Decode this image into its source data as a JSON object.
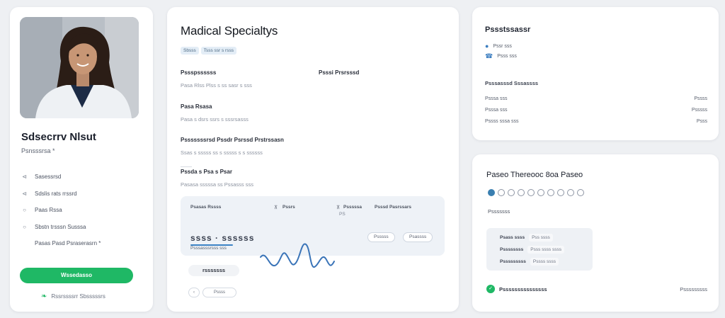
{
  "profile": {
    "name": "Sdsecrrv Nlsut",
    "role": "Psnsssrsa *",
    "items": [
      {
        "icon": "bullet-icon",
        "label": "Sasessrsd"
      },
      {
        "icon": "bullet-icon",
        "label": "Sdslis rats rrssrd"
      },
      {
        "icon": "circle-icon",
        "label": "Paas Rssa"
      },
      {
        "icon": "circle-icon",
        "label": "Sbstn trsssn Susssa"
      },
      {
        "icon": "none",
        "label": "Pasas Pasd Psraserasrn  *"
      }
    ],
    "cta_label": "Wssedasso",
    "footer_label": "Rssrssssrr  Sbsssssrs"
  },
  "main": {
    "title": "Madical Specialtys",
    "tags": [
      "Sbsss",
      "Tsss ssr s rsss"
    ],
    "sections": [
      {
        "heading": "Pssspssssss",
        "sub": "Pasa Rlss   Plss s ss sasr s sss"
      },
      {
        "heading": "Psssi Prsrsssd",
        "sub": ""
      },
      {
        "heading": "Pasa Rsasa",
        "sub": "Pasa s dsrs ssrs s sssrsasss"
      },
      {
        "heading": "Psssssssrsd  Pssdr  Psrssd  Prstrssasn",
        "sub": "Ssas s sssss ss s sssss s s ssssss"
      },
      {
        "heading": "Pssda s Psa s Psar",
        "sub": "Pasasa  sssssa ss Pssasss sss"
      }
    ],
    "stats": {
      "labels": [
        "Psasas Rssss",
        "Pssrs",
        "Psssssa",
        "Psssd  Pasrssars"
      ],
      "sub": "PS",
      "big_value": "ssss  ·  ssssss",
      "big_caption": "Psssasssrsss sss",
      "pills": [
        "Psssss",
        "Psassss"
      ]
    },
    "dark_pill": "rsssssss",
    "pager": [
      "‹",
      "Pssss",
      "›"
    ]
  },
  "side_top": {
    "title": "Pssstssassr",
    "lines": [
      "Pssr  sss",
      "Psss  sss"
    ],
    "heading": "Psssasssd  Sssassss",
    "rows": [
      {
        "k": "Psssa  sss",
        "v": "Pssss"
      },
      {
        "k": "Psssa sss",
        "v": "Psssss"
      },
      {
        "k": "Pssss sssa  sss",
        "v": "Psss"
      }
    ]
  },
  "side_bot": {
    "title": "Paseo Thereooc 8oa Paseo",
    "dots": 10,
    "active_dot": 0,
    "label": "Psssssss",
    "slots": [
      {
        "a": "Psass ssss",
        "b": "Pss  ssss"
      },
      {
        "a": "Pssssssss",
        "b": "Psss ssss ssss"
      },
      {
        "a": "Psssssssss",
        "b": "Pssss ssss"
      }
    ],
    "footer_left": "Psssssssssssssss",
    "footer_right": "Psssssssss"
  },
  "colors": {
    "accent_green": "#1fb865",
    "accent_blue": "#3b82c4",
    "background": "#eef0f3"
  }
}
